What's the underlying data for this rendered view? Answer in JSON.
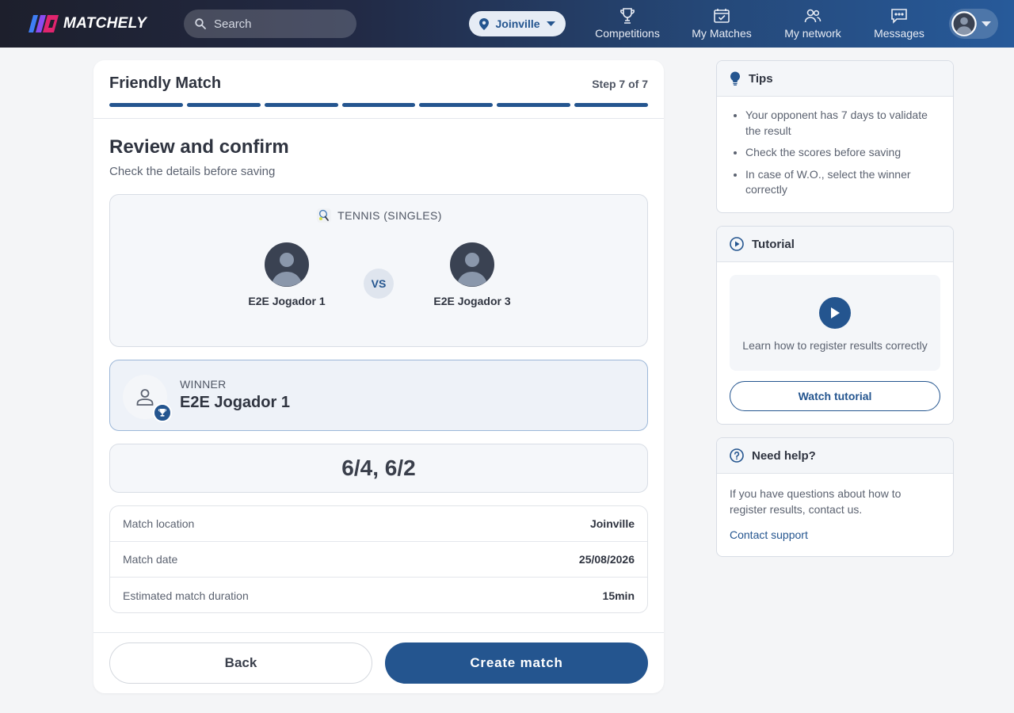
{
  "brand": {
    "name": "MATCHELY"
  },
  "search": {
    "placeholder": "Search"
  },
  "location_pill": {
    "label": "Joinville"
  },
  "nav": {
    "competitions": "Competitions",
    "my_matches": "My Matches",
    "my_network": "My network",
    "messages": "Messages"
  },
  "card": {
    "title": "Friendly Match",
    "step": "Step 7 of 7",
    "progress": {
      "current": 7,
      "total": 7
    },
    "section_title": "Review and confirm",
    "section_subtitle": "Check the details before saving",
    "sport": "TENNIS (SINGLES)",
    "player1": "E2E Jogador 1",
    "player2": "E2E Jogador 3",
    "vs_label": "VS",
    "winner_label": "WINNER",
    "winner_name": "E2E Jogador 1",
    "score": "6/4, 6/2",
    "details": [
      {
        "key": "Match location",
        "value": "Joinville"
      },
      {
        "key": "Match date",
        "value": "25/08/2026"
      },
      {
        "key": "Estimated match duration",
        "value": "15min"
      }
    ],
    "back_label": "Back",
    "create_label": "Create match"
  },
  "tips": {
    "title": "Tips",
    "items": [
      "Your opponent has 7 days to validate the result",
      "Check the scores before saving",
      "In case of W.O., select the winner correctly"
    ]
  },
  "tutorial": {
    "title": "Tutorial",
    "text": "Learn how to register results correctly",
    "button": "Watch tutorial"
  },
  "help": {
    "title": "Need help?",
    "text": "If you have questions about how to register results, contact us.",
    "link": "Contact support"
  },
  "colors": {
    "primary": "#24558f",
    "accent_pink": "#e0246e",
    "accent_blue": "#3f7ef5"
  }
}
